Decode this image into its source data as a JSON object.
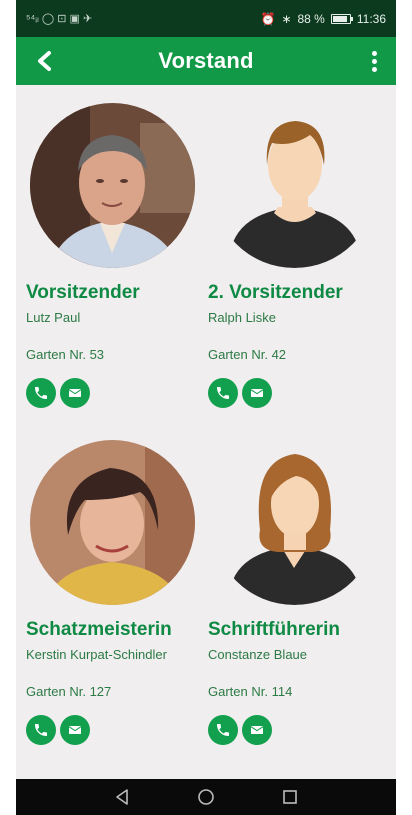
{
  "status_bar": {
    "left_icons": "⁵⁴ᵢₗ ◯ ⊡ ▣ ✈",
    "bluetooth": "∗",
    "battery_text": "88 %",
    "battery_level": 0.88,
    "time": "11:36"
  },
  "app_bar": {
    "title": "Vorstand",
    "back_icon": "chevron-left-icon",
    "menu_icon": "more-vertical-icon"
  },
  "members": [
    {
      "role": "Vorsitzender",
      "name": "Lutz Paul",
      "garden": "Garten Nr. 53",
      "avatar": "photo-man"
    },
    {
      "role": "2. Vorsitzender",
      "name": "Ralph Liske",
      "garden": "Garten Nr. 42",
      "avatar": "placeholder-male"
    },
    {
      "role": "Schatzmeisterin",
      "name": "Kerstin Kurpat-Schindler",
      "garden": "Garten Nr. 127",
      "avatar": "photo-woman"
    },
    {
      "role": "Schriftführerin",
      "name": "Constanze Blaue",
      "garden": "Garten Nr. 114",
      "avatar": "placeholder-female"
    }
  ],
  "colors": {
    "primary": "#119948",
    "status_bar": "#0c3a1f",
    "background": "#f0eeee",
    "text_green": "#0f8a44"
  },
  "nav_bar": {
    "back_icon": "triangle-back-icon",
    "home_icon": "circle-home-icon",
    "recents_icon": "square-recents-icon"
  }
}
